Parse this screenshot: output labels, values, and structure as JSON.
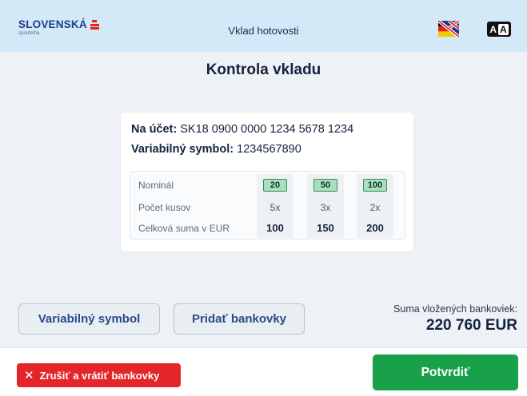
{
  "header": {
    "brand": "SLOVENSKÁ",
    "brand_sub": "sporiteľňa",
    "title": "Vklad hotovosti",
    "language_icon": "uk-flag-icon",
    "accessibility_label_1": "A",
    "accessibility_label_2": "A"
  },
  "page": {
    "title": "Kontrola vkladu"
  },
  "summary": {
    "account_label": "Na účet:",
    "account_value": "SK18 0900 0000 1234 5678 1234",
    "vs_label": "Variabilný symbol:",
    "vs_value": "1234567890"
  },
  "table": {
    "row_labels": [
      "Nominál",
      "Počet kusov",
      "Celková suma v EUR"
    ],
    "columns": [
      {
        "denomination": "20",
        "count": "5x",
        "total": "100"
      },
      {
        "denomination": "50",
        "count": "3x",
        "total": "150"
      },
      {
        "denomination": "100",
        "count": "2x",
        "total": "200"
      }
    ]
  },
  "actions": {
    "variable_symbol": "Variabilný symbol",
    "add_notes": "Pridať bankovky",
    "sum_caption": "Suma vložených bankoviek:",
    "sum_value": "220 760 EUR"
  },
  "footer": {
    "cancel_icon": "close-icon",
    "cancel_label": "Zrušiť a vrátiť bankovky",
    "confirm_label": "Potvrdiť"
  },
  "colors": {
    "header_bg": "#d3e9f8",
    "brand_blue": "#1d3b8c",
    "brand_red": "#e2231a",
    "cancel_red": "#e4262b",
    "confirm_green": "#18a04a",
    "badge_green": "#a8e0be"
  }
}
